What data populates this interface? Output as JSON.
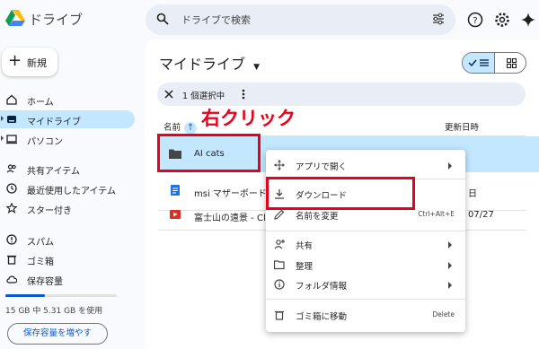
{
  "app": {
    "name": "ドライブ"
  },
  "search": {
    "placeholder": "ドライブで検索"
  },
  "sidebar": {
    "new_label": "新規",
    "items": [
      {
        "label": "ホーム",
        "icon": "home-icon"
      },
      {
        "label": "マイドライブ",
        "icon": "drive-icon",
        "active": true
      },
      {
        "label": "パソコン",
        "icon": "computer-icon"
      },
      {
        "label": "共有アイテム",
        "icon": "people-icon"
      },
      {
        "label": "最近使用したアイテム",
        "icon": "clock-icon"
      },
      {
        "label": "スター付き",
        "icon": "star-icon"
      },
      {
        "label": "スパム",
        "icon": "spam-icon"
      },
      {
        "label": "ゴミ箱",
        "icon": "trash-icon"
      },
      {
        "label": "保存容量",
        "icon": "cloud-icon"
      }
    ],
    "storage_text": "15 GB 中 5.31 GB を使用",
    "storage_fraction": 0.354,
    "buy_label": "保存容量を増やす"
  },
  "main": {
    "title": "マイドライブ",
    "selection_text": "1 個選択中",
    "col_name": "名前",
    "col_modified": "更新日時",
    "rows": [
      {
        "name": "AI cats",
        "date": "",
        "icon": "folder-icon"
      },
      {
        "name": "msi マザーボード",
        "date": "日",
        "icon": "doc-icon"
      },
      {
        "name": "富士山の遠景 - Cli",
        "date": "07/27",
        "icon": "video-icon"
      }
    ]
  },
  "context_menu": {
    "items": [
      {
        "label": "アプリで開く",
        "icon": "move-icon",
        "submenu": true
      },
      {
        "label": "ダウンロード",
        "icon": "download-icon"
      },
      {
        "label": "名前を変更",
        "icon": "edit-icon",
        "shortcut": "Ctrl+Alt+E"
      },
      {
        "label": "共有",
        "icon": "person-add-icon",
        "submenu": true
      },
      {
        "label": "整理",
        "icon": "folder-open-icon",
        "submenu": true
      },
      {
        "label": "フォルダ情報",
        "icon": "info-icon",
        "submenu": true
      },
      {
        "label": "ゴミ箱に移動",
        "icon": "trash-icon",
        "shortcut": "Delete"
      }
    ]
  },
  "annotation": {
    "text": "右クリック",
    "color": "#e8001c"
  },
  "colors": {
    "accent": "#0b57d0",
    "selected": "#c2e7ff",
    "surface": "#f8fafd"
  }
}
